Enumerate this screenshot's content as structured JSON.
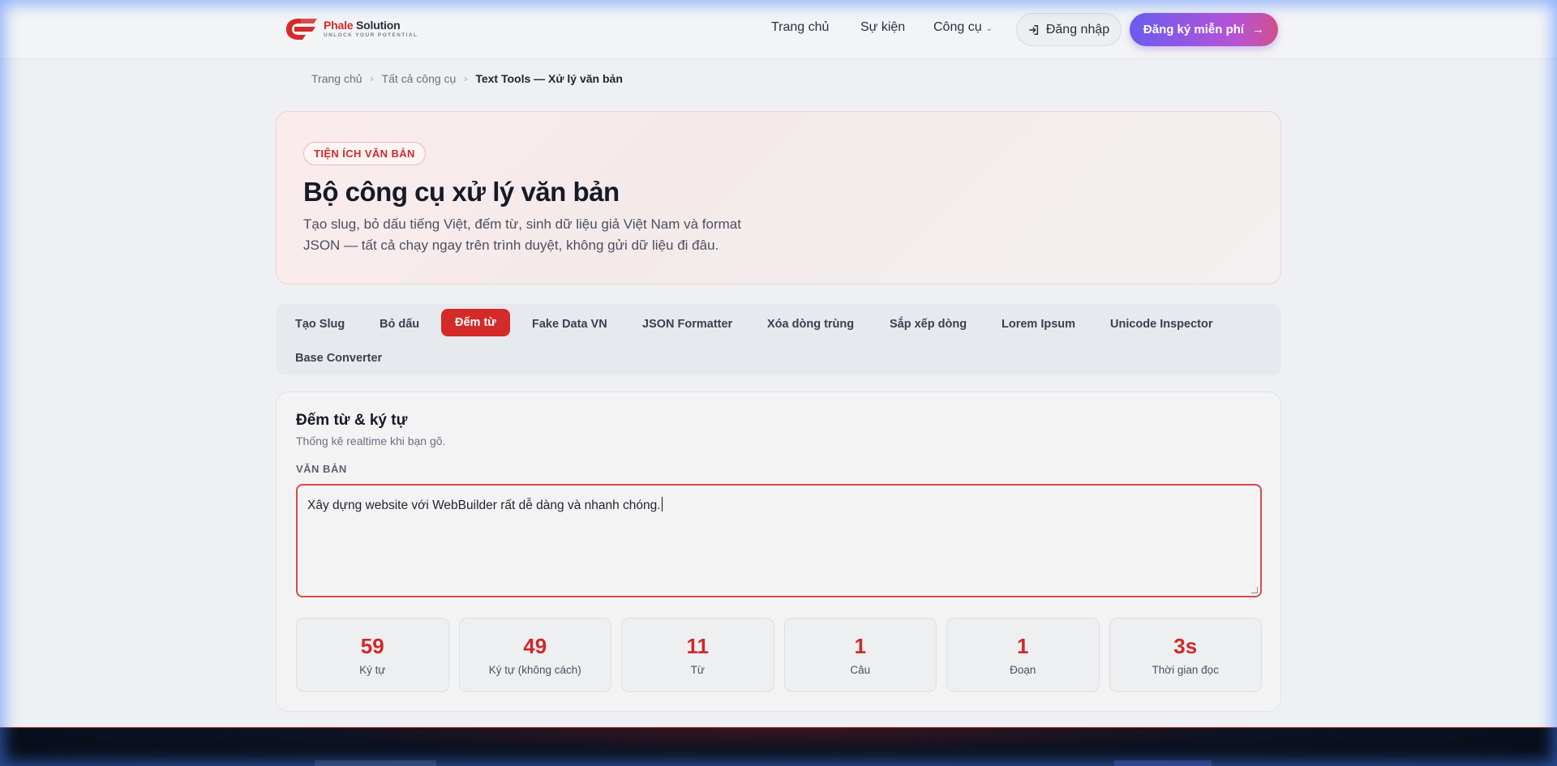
{
  "header": {
    "logo": {
      "brand": "Phale",
      "name": " Solution",
      "tagline": "UNLOCK YOUR POTENTIAL"
    },
    "nav": [
      {
        "label": "Trang chủ"
      },
      {
        "label": "Sự kiện"
      },
      {
        "label": "Công cụ"
      }
    ],
    "login_label": "Đăng nhập",
    "signup_label": "Đăng ký miễn phí",
    "signup_arrow": "→",
    "dropdown_glyph": "⌄"
  },
  "breadcrumb": {
    "items": [
      "Trang chủ",
      "Tất cả công cụ",
      "Text Tools — Xử lý văn bản"
    ],
    "separator": "›"
  },
  "hero": {
    "badge": "TIỆN ÍCH VĂN BẢN",
    "title": "Bộ công cụ xử lý văn bản",
    "description": "Tạo slug, bỏ dấu tiếng Việt, đếm từ, sinh dữ liệu giả Việt Nam và format JSON — tất cả chạy ngay trên trình duyệt, không gửi dữ liệu đi đâu."
  },
  "tabs": [
    {
      "label": "Tạo Slug",
      "active": false
    },
    {
      "label": "Bỏ dấu",
      "active": false
    },
    {
      "label": "Đếm từ",
      "active": true
    },
    {
      "label": "Fake Data VN",
      "active": false
    },
    {
      "label": "JSON Formatter",
      "active": false
    },
    {
      "label": "Xóa dòng trùng",
      "active": false
    },
    {
      "label": "Sắp xếp dòng",
      "active": false
    },
    {
      "label": "Lorem Ipsum",
      "active": false
    },
    {
      "label": "Unicode Inspector",
      "active": false
    },
    {
      "label": "Base Converter",
      "active": false
    }
  ],
  "tool": {
    "title": "Đếm từ & ký tự",
    "subtitle": "Thống kê realtime khi bạn gõ.",
    "field_label": "VĂN BẢN",
    "text_value": "Xây dựng website với WebBuilder rất dễ dàng và nhanh chóng.",
    "stats": [
      {
        "value": "59",
        "label": "Ký tự"
      },
      {
        "value": "49",
        "label": "Ký tự (không cách)"
      },
      {
        "value": "11",
        "label": "Từ"
      },
      {
        "value": "1",
        "label": "Câu"
      },
      {
        "value": "1",
        "label": "Đoạn"
      },
      {
        "value": "3s",
        "label": "Thời gian đọc"
      }
    ]
  },
  "colors": {
    "accent": "#d42a2a",
    "signup_gradient_start": "#6a5cf0",
    "signup_gradient_end": "#d0508e",
    "footer_bg": "#060b16"
  }
}
